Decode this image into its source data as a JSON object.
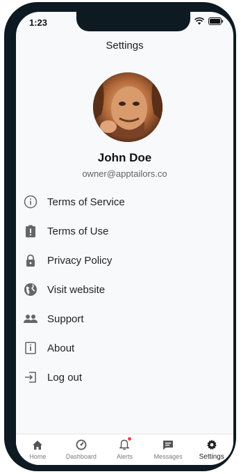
{
  "status_bar": {
    "time": "1:23"
  },
  "header": {
    "title": "Settings"
  },
  "profile": {
    "name": "John Doe",
    "email": "owner@apptailors.co"
  },
  "menu": [
    {
      "label": "Terms of Service",
      "icon": "info-circle-icon"
    },
    {
      "label": "Terms of Use",
      "icon": "clipboard-alert-icon"
    },
    {
      "label": "Privacy Policy",
      "icon": "lock-icon"
    },
    {
      "label": "Visit website",
      "icon": "globe-icon"
    },
    {
      "label": "Support",
      "icon": "people-icon"
    },
    {
      "label": "About",
      "icon": "info-box-icon"
    },
    {
      "label": "Log out",
      "icon": "logout-icon"
    }
  ],
  "tabbar": {
    "items": [
      {
        "label": "Home",
        "icon": "home-icon"
      },
      {
        "label": "Dashboard",
        "icon": "dashboard-icon"
      },
      {
        "label": "Alerts",
        "icon": "bell-icon"
      },
      {
        "label": "Messages",
        "icon": "chat-icon"
      },
      {
        "label": "Settings",
        "icon": "gear-icon",
        "active": true
      }
    ]
  },
  "colors": {
    "frame": "#0e1a22",
    "background": "#f8f9fb",
    "alert_dot": "#e8473b"
  }
}
